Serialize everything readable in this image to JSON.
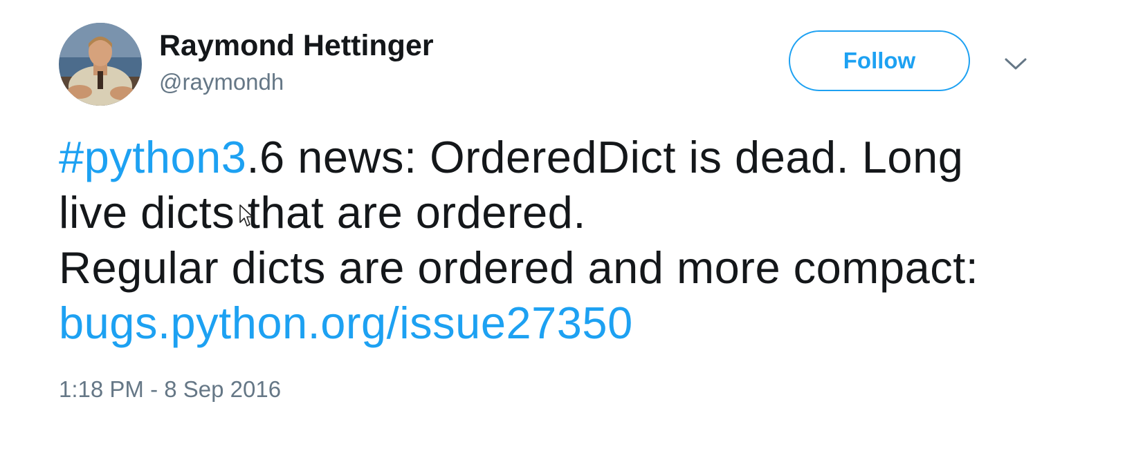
{
  "author": {
    "display_name": "Raymond Hettinger",
    "handle": "@raymondh",
    "avatar_icon": "user-photo-icon"
  },
  "actions": {
    "follow_label": "Follow",
    "more_icon": "chevron-down-icon"
  },
  "tweet": {
    "hashtag": "#python3",
    "line1_rest": ".6 news:  OrderedDict is dead. Long",
    "line2": "live dicts that are ordered.",
    "line3": "Regular dicts are ordered and more compact:",
    "link": "bugs.python.org/issue27350"
  },
  "timestamp": "1:18 PM - 8 Sep 2016",
  "colors": {
    "accent": "#1da1f2",
    "text": "#14171a",
    "secondary": "#657786",
    "background": "#ffffff"
  }
}
